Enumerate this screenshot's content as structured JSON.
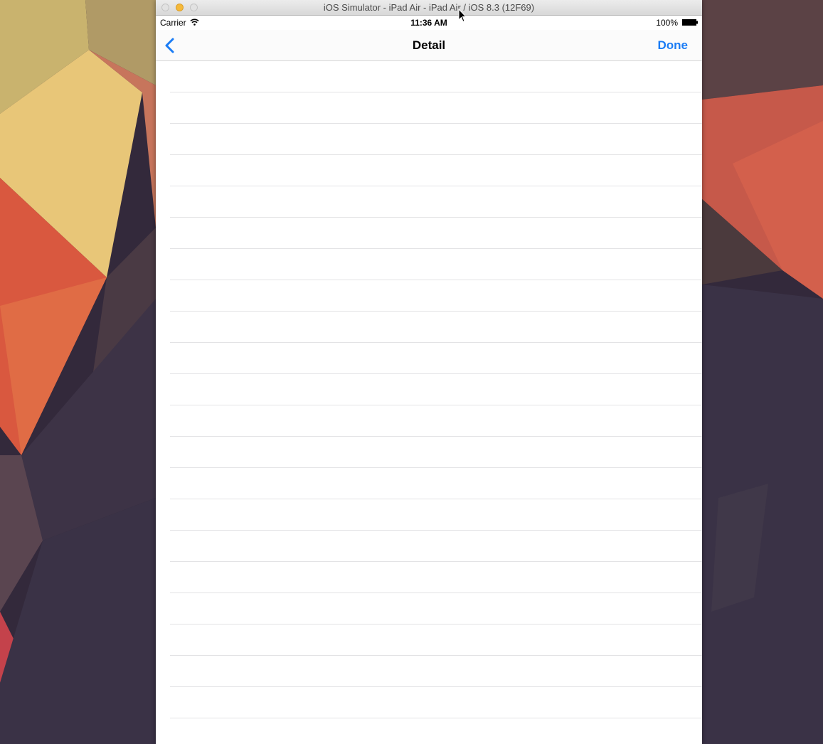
{
  "window": {
    "title": "iOS Simulator - iPad Air - iPad Air / iOS 8.3 (12F69)"
  },
  "status_bar": {
    "carrier": "Carrier",
    "time": "11:36 AM",
    "battery": "100%"
  },
  "nav_bar": {
    "title": "Detail",
    "done_label": "Done",
    "accent_color": "#1a7cf5"
  },
  "table": {
    "row_count": 21
  },
  "icons": {
    "back": "chevron-left-icon",
    "wifi": "wifi-icon",
    "battery": "battery-icon",
    "cursor": "mouse-pointer-icon"
  }
}
